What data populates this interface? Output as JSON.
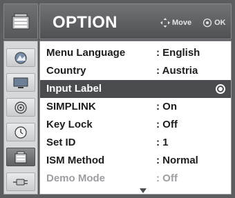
{
  "header": {
    "title": "OPTION",
    "move_hint": "Move",
    "ok_hint": "OK"
  },
  "sidebar": {
    "items": [
      {
        "name": "picture",
        "icon": "picture-icon",
        "active": false
      },
      {
        "name": "screen",
        "icon": "monitor-icon",
        "active": false
      },
      {
        "name": "audio",
        "icon": "speaker-icon",
        "active": false
      },
      {
        "name": "time",
        "icon": "clock-icon",
        "active": false
      },
      {
        "name": "option",
        "icon": "option-icon",
        "active": true
      },
      {
        "name": "connection",
        "icon": "plug-icon",
        "active": false
      }
    ]
  },
  "menu": {
    "items": [
      {
        "label": "Menu Language",
        "value": ": English"
      },
      {
        "label": "Country",
        "value": ": Austria"
      },
      {
        "label": "Input Label",
        "value": ""
      },
      {
        "label": "SIMPLINK",
        "value": ": On"
      },
      {
        "label": "Key Lock",
        "value": ": Off"
      },
      {
        "label": "Set ID",
        "value": ": 1"
      },
      {
        "label": "ISM Method",
        "value": ": Normal"
      },
      {
        "label": "Demo Mode",
        "value": ": Off"
      }
    ]
  },
  "colors": {
    "selected_row": "#4a4c50",
    "disabled_text": "#9c9ea1"
  }
}
